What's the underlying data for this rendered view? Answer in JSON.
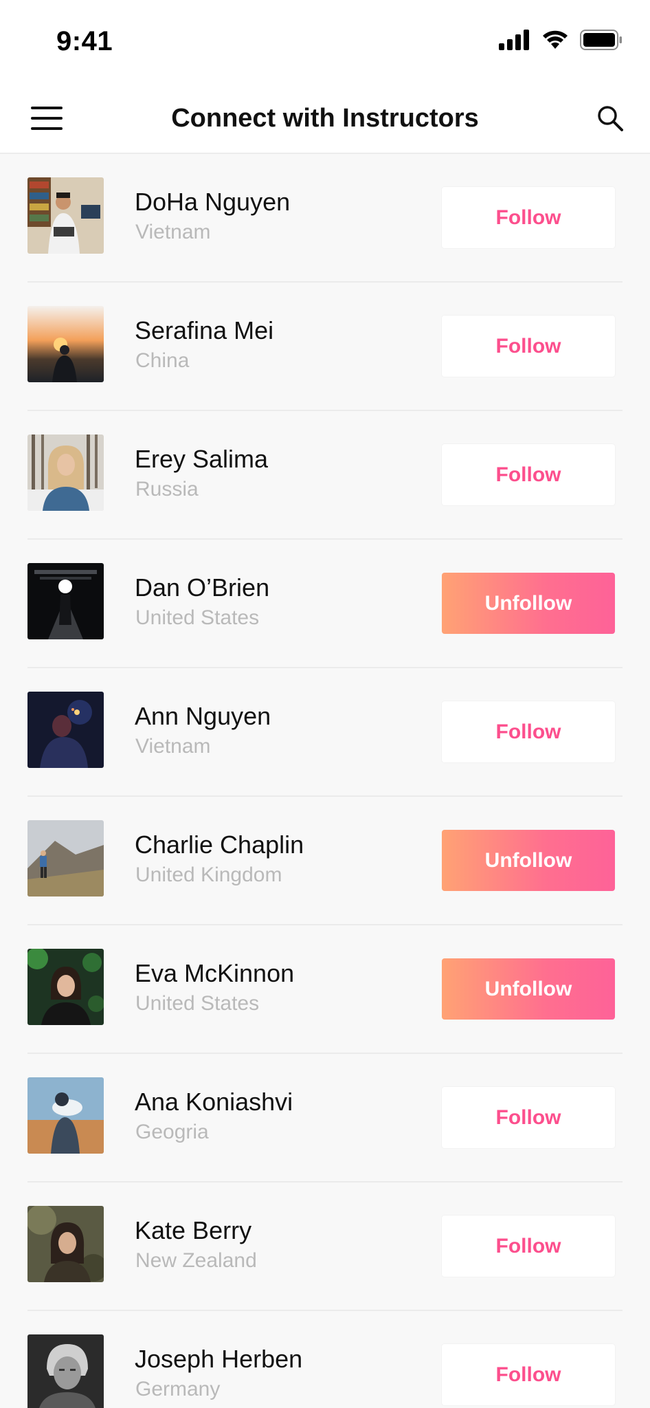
{
  "status_bar": {
    "time": "9:41",
    "icons": [
      "signal-icon",
      "wifi-icon",
      "battery-icon"
    ]
  },
  "nav": {
    "title": "Connect with Instructors",
    "left_icon": "menu-icon",
    "right_icon": "search-icon"
  },
  "colors": {
    "accent": "#fc4f8d",
    "gradient_start": "#ffa274",
    "gradient_end": "#fe6298",
    "secondary_text": "#b9b9b9"
  },
  "instructors": [
    {
      "name": "DoHa Nguyen",
      "country": "Vietnam",
      "action": "Follow"
    },
    {
      "name": "Serafina Mei",
      "country": "China",
      "action": "Follow"
    },
    {
      "name": "Erey Salima",
      "country": "Russia",
      "action": "Follow"
    },
    {
      "name": "Dan O’Brien",
      "country": "United States",
      "action": "Unfollow"
    },
    {
      "name": "Ann Nguyen",
      "country": "Vietnam",
      "action": "Follow"
    },
    {
      "name": "Charlie Chaplin",
      "country": "United Kingdom",
      "action": "Unfollow"
    },
    {
      "name": "Eva McKinnon",
      "country": "United States",
      "action": "Unfollow"
    },
    {
      "name": "Ana Koniashvi",
      "country": "Geogria",
      "action": "Follow"
    },
    {
      "name": "Kate Berry",
      "country": "New Zealand",
      "action": "Follow"
    },
    {
      "name": "Joseph Herben",
      "country": "Germany",
      "action": "Follow"
    }
  ]
}
